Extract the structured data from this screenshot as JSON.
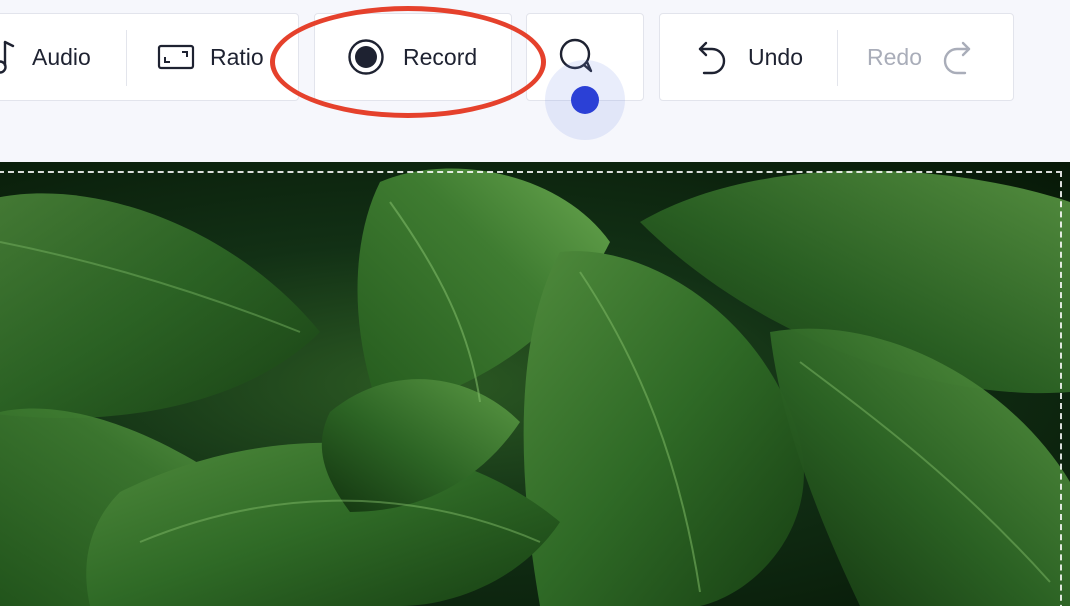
{
  "toolbar": {
    "audio_label": "Audio",
    "ratio_label": "Ratio",
    "record_label": "Record",
    "undo_label": "Undo",
    "redo_label": "Redo"
  },
  "canvas": {
    "image_subject": "basil-leaves",
    "crop_outline": "dashed-white"
  },
  "annotations": {
    "highlight_target": "record-button",
    "highlight_color": "#e5412c",
    "cursor_color": "#2b40d6"
  },
  "colors": {
    "toolbar_bg": "#f6f7fc",
    "text": "#1e2231",
    "disabled_text": "#a9adb9"
  }
}
